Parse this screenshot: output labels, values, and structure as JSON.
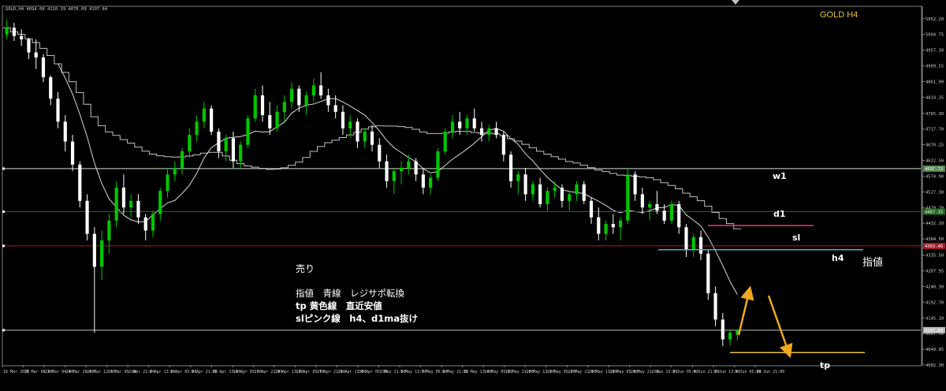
{
  "chart_window": {
    "symbol_header": "GOLD,H4  4094.08 4110.19 4076.09 4107.84",
    "title_overlay": "GOLD H4",
    "colors": {
      "background": "#000000",
      "candle_up": "#00c800",
      "candle_down": "#ffffff",
      "ma_line": "#d9d9d9",
      "ma_step_line": "#c0c0c0",
      "grid_border": "#808080",
      "level_w1": "#c8e6c8",
      "level_d1": "#1f6b1f",
      "level_red": "#a81b2a",
      "level_current": "#bfbfbf",
      "line_h4_entry": "#58a8d6",
      "line_sl": "#e8376a",
      "line_tp": "#e6c23a",
      "arrow": "#f0a820"
    }
  },
  "annotations": {
    "labels": {
      "w1": "w1",
      "d1": "d1",
      "sl": "sl",
      "h4": "h4",
      "limit": "指値",
      "tp": "tp"
    },
    "note": {
      "heading": "売り",
      "line1": "指値　青線　レジサポ転換",
      "line2": "tp 黄色線　直近安値",
      "line3": "slピンク線　h4、d1ma抜け"
    }
  },
  "price_axis": {
    "ticks": [
      "5052.20",
      "5004.75",
      "4957.30",
      "4909.55",
      "4861.90",
      "4814.35",
      "4765.30",
      "4717.70",
      "4670.25",
      "4622.50",
      "4574.90",
      "4527.30",
      "4479.70",
      "4432.10",
      "4384.50",
      "4335.50",
      "4287.95",
      "4240.30",
      "4192.70",
      "4145.10",
      "4097.50",
      "4049.95",
      "4002.30"
    ],
    "markers": [
      {
        "label": "4597.72",
        "price": 4597.72,
        "color": "#5a8a5a"
      },
      {
        "label": "4467.15",
        "price": 4467.15,
        "color": "#1f6b1f"
      },
      {
        "label": "4363.46",
        "price": 4363.46,
        "color": "#a81b2a"
      },
      {
        "label": "4107.84",
        "price": 4107.84,
        "color": "#bfbfbf"
      }
    ]
  },
  "time_axis": {
    "ticks": [
      "16 Mar 2026",
      "19 Mar 08:00",
      "23 Mar 04:00",
      "24 Mar 20:00",
      "26 Mar 12:00",
      "31 Mar 05:00",
      "2 Apr 21:00",
      "6 Apr 13:00",
      "8 Apr 05:00",
      "9 Apr 21:00",
      "15 Apr 13:00",
      "16 Apr 05:00",
      "17 Apr 21:00",
      "20 Apr 13:00",
      "23 Apr 05:00",
      "27 Apr 21:00",
      "28 Apr 13:00",
      "30 Apr 05:00",
      "1 May 21:00",
      "5 May 13:00",
      "7 May 05:00",
      "8 May 21:00",
      "12 May 13:00",
      "14 May 05:00",
      "15 May 21:00",
      "19 May 13:00",
      "21 May 05:00",
      "22 May 21:00",
      "26 May 13:00",
      "28 May 05:00",
      "29 May 21:00",
      "2 Jun 13:00",
      "3 Jun 05:00",
      "4 Jun 21:00",
      "8 Jun 13:00",
      "9 Jun 05:00",
      "10 Jun 21:00"
    ]
  },
  "chart_data": {
    "type": "candlestick",
    "symbol": "GOLD",
    "timeframe": "H4",
    "ylim": [
      4002.3,
      5090.0
    ],
    "candles": [
      [
        5005,
        5050,
        4990,
        5025
      ],
      [
        5025,
        5040,
        4985,
        5000
      ],
      [
        5000,
        5020,
        4970,
        4990
      ],
      [
        4990,
        4995,
        4930,
        4950
      ],
      [
        4950,
        4990,
        4900,
        4935
      ],
      [
        4935,
        4945,
        4860,
        4875
      ],
      [
        4875,
        4880,
        4790,
        4810
      ],
      [
        4810,
        4830,
        4720,
        4740
      ],
      [
        4740,
        4760,
        4650,
        4680
      ],
      [
        4680,
        4700,
        4590,
        4610
      ],
      [
        4610,
        4620,
        4480,
        4500
      ],
      [
        4500,
        4520,
        4380,
        4400
      ],
      [
        4400,
        4420,
        4100,
        4300
      ],
      [
        4300,
        4410,
        4260,
        4380
      ],
      [
        4380,
        4460,
        4340,
        4440
      ],
      [
        4440,
        4560,
        4420,
        4540
      ],
      [
        4540,
        4580,
        4460,
        4480
      ],
      [
        4480,
        4520,
        4450,
        4500
      ],
      [
        4500,
        4520,
        4430,
        4450
      ],
      [
        4450,
        4460,
        4380,
        4410
      ],
      [
        4410,
        4470,
        4390,
        4460
      ],
      [
        4460,
        4540,
        4440,
        4530
      ],
      [
        4530,
        4600,
        4510,
        4580
      ],
      [
        4580,
        4620,
        4560,
        4600
      ],
      [
        4600,
        4660,
        4580,
        4650
      ],
      [
        4650,
        4720,
        4630,
        4700
      ],
      [
        4700,
        4760,
        4680,
        4740
      ],
      [
        4740,
        4800,
        4720,
        4780
      ],
      [
        4780,
        4790,
        4700,
        4710
      ],
      [
        4710,
        4720,
        4630,
        4650
      ],
      [
        4650,
        4700,
        4620,
        4690
      ],
      [
        4690,
        4710,
        4600,
        4620
      ],
      [
        4620,
        4680,
        4600,
        4670
      ],
      [
        4670,
        4760,
        4660,
        4750
      ],
      [
        4750,
        4840,
        4740,
        4820
      ],
      [
        4820,
        4850,
        4740,
        4760
      ],
      [
        4760,
        4800,
        4700,
        4720
      ],
      [
        4720,
        4790,
        4710,
        4770
      ],
      [
        4770,
        4820,
        4740,
        4800
      ],
      [
        4800,
        4860,
        4780,
        4840
      ],
      [
        4840,
        4850,
        4770,
        4790
      ],
      [
        4790,
        4830,
        4760,
        4820
      ],
      [
        4820,
        4870,
        4800,
        4850
      ],
      [
        4850,
        4890,
        4810,
        4820
      ],
      [
        4820,
        4840,
        4770,
        4790
      ],
      [
        4790,
        4820,
        4750,
        4770
      ],
      [
        4770,
        4790,
        4700,
        4720
      ],
      [
        4720,
        4760,
        4690,
        4740
      ],
      [
        4740,
        4750,
        4660,
        4680
      ],
      [
        4680,
        4720,
        4660,
        4710
      ],
      [
        4710,
        4730,
        4650,
        4670
      ],
      [
        4670,
        4690,
        4600,
        4620
      ],
      [
        4620,
        4640,
        4540,
        4560
      ],
      [
        4560,
        4600,
        4520,
        4590
      ],
      [
        4590,
        4620,
        4550,
        4600
      ],
      [
        4600,
        4640,
        4580,
        4620
      ],
      [
        4620,
        4630,
        4560,
        4580
      ],
      [
        4580,
        4600,
        4520,
        4540
      ],
      [
        4540,
        4580,
        4520,
        4570
      ],
      [
        4570,
        4660,
        4560,
        4650
      ],
      [
        4650,
        4720,
        4640,
        4710
      ],
      [
        4710,
        4760,
        4690,
        4740
      ],
      [
        4740,
        4770,
        4700,
        4720
      ],
      [
        4720,
        4760,
        4700,
        4750
      ],
      [
        4750,
        4780,
        4710,
        4720
      ],
      [
        4720,
        4740,
        4680,
        4700
      ],
      [
        4700,
        4730,
        4680,
        4720
      ],
      [
        4720,
        4740,
        4690,
        4700
      ],
      [
        4700,
        4710,
        4620,
        4640
      ],
      [
        4640,
        4650,
        4540,
        4560
      ],
      [
        4560,
        4590,
        4520,
        4580
      ],
      [
        4580,
        4600,
        4500,
        4520
      ],
      [
        4520,
        4560,
        4500,
        4550
      ],
      [
        4550,
        4570,
        4480,
        4490
      ],
      [
        4490,
        4540,
        4470,
        4530
      ],
      [
        4530,
        4560,
        4510,
        4540
      ],
      [
        4540,
        4550,
        4480,
        4500
      ],
      [
        4500,
        4530,
        4470,
        4520
      ],
      [
        4520,
        4560,
        4500,
        4550
      ],
      [
        4550,
        4560,
        4490,
        4500
      ],
      [
        4500,
        4510,
        4430,
        4450
      ],
      [
        4450,
        4480,
        4380,
        4400
      ],
      [
        4400,
        4440,
        4380,
        4430
      ],
      [
        4430,
        4460,
        4400,
        4420
      ],
      [
        4420,
        4450,
        4380,
        4440
      ],
      [
        4440,
        4600,
        4430,
        4580
      ],
      [
        4580,
        4590,
        4500,
        4520
      ],
      [
        4520,
        4540,
        4460,
        4480
      ],
      [
        4480,
        4500,
        4440,
        4490
      ],
      [
        4490,
        4530,
        4460,
        4470
      ],
      [
        4470,
        4490,
        4430,
        4440
      ],
      [
        4440,
        4500,
        4430,
        4490
      ],
      [
        4490,
        4500,
        4400,
        4420
      ],
      [
        4420,
        4430,
        4330,
        4350
      ],
      [
        4350,
        4400,
        4330,
        4390
      ],
      [
        4390,
        4410,
        4320,
        4340
      ],
      [
        4340,
        4350,
        4200,
        4220
      ],
      [
        4220,
        4240,
        4120,
        4140
      ],
      [
        4140,
        4160,
        4060,
        4080
      ],
      [
        4080,
        4110,
        4060,
        4100
      ],
      [
        4094.08,
        4110.19,
        4076.09,
        4107.84
      ]
    ],
    "levels": [
      {
        "name": "w1",
        "price": 4597.72
      },
      {
        "name": "d1",
        "price": 4467.15
      },
      {
        "name": "red",
        "price": 4363.46
      },
      {
        "name": "current",
        "price": 4107.84
      }
    ],
    "trade_plan": {
      "entry_h4_line": 4352,
      "stop_loss_line": 4425,
      "take_profit_line": 4040
    }
  }
}
